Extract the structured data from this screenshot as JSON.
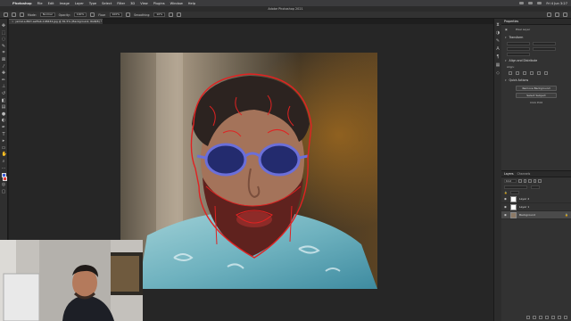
{
  "menubar": {
    "app": "Photoshop",
    "items": [
      "File",
      "Edit",
      "Image",
      "Layer",
      "Type",
      "Select",
      "Filter",
      "3D",
      "View",
      "Plugins",
      "Window",
      "Help"
    ],
    "clock": "Fri 4 Jun 3:27"
  },
  "window": {
    "title": "Adobe Photoshop 2021"
  },
  "options": {
    "mode_label": "Mode:",
    "mode_value": "Normal",
    "opacity_label": "Opacity:",
    "opacity_value": "100%",
    "flow_label": "Flow:",
    "flow_value": "100%",
    "smoothing_label": "Smoothing:",
    "smoothing_value": "10%"
  },
  "document": {
    "tab": "jamal-s-86rt-selfieb-108434.jpg @ 81.5% (Background, RGB/8) *"
  },
  "properties": {
    "tabs": [
      "Properties"
    ],
    "pixel_layer": "Pixel Layer",
    "transform": "Transform",
    "align": "Align and Distribute",
    "align_sub": "Align:",
    "quick_actions": "Quick Actions",
    "btn_remove_bg": "Remove Background",
    "btn_select_subject": "Select Subject",
    "btn_more": "Click Edit"
  },
  "layers": {
    "tabs": [
      "Layers",
      "Channels"
    ],
    "kind": "Kind",
    "items": [
      {
        "name": "Layer 2",
        "thumb": "white"
      },
      {
        "name": "Layer 1",
        "thumb": "white"
      },
      {
        "name": "Background",
        "thumb": "photo"
      }
    ]
  },
  "colors": {
    "foreground": "#3b5bd6",
    "background": "#e23c3c",
    "mask_red": "#e02222"
  }
}
